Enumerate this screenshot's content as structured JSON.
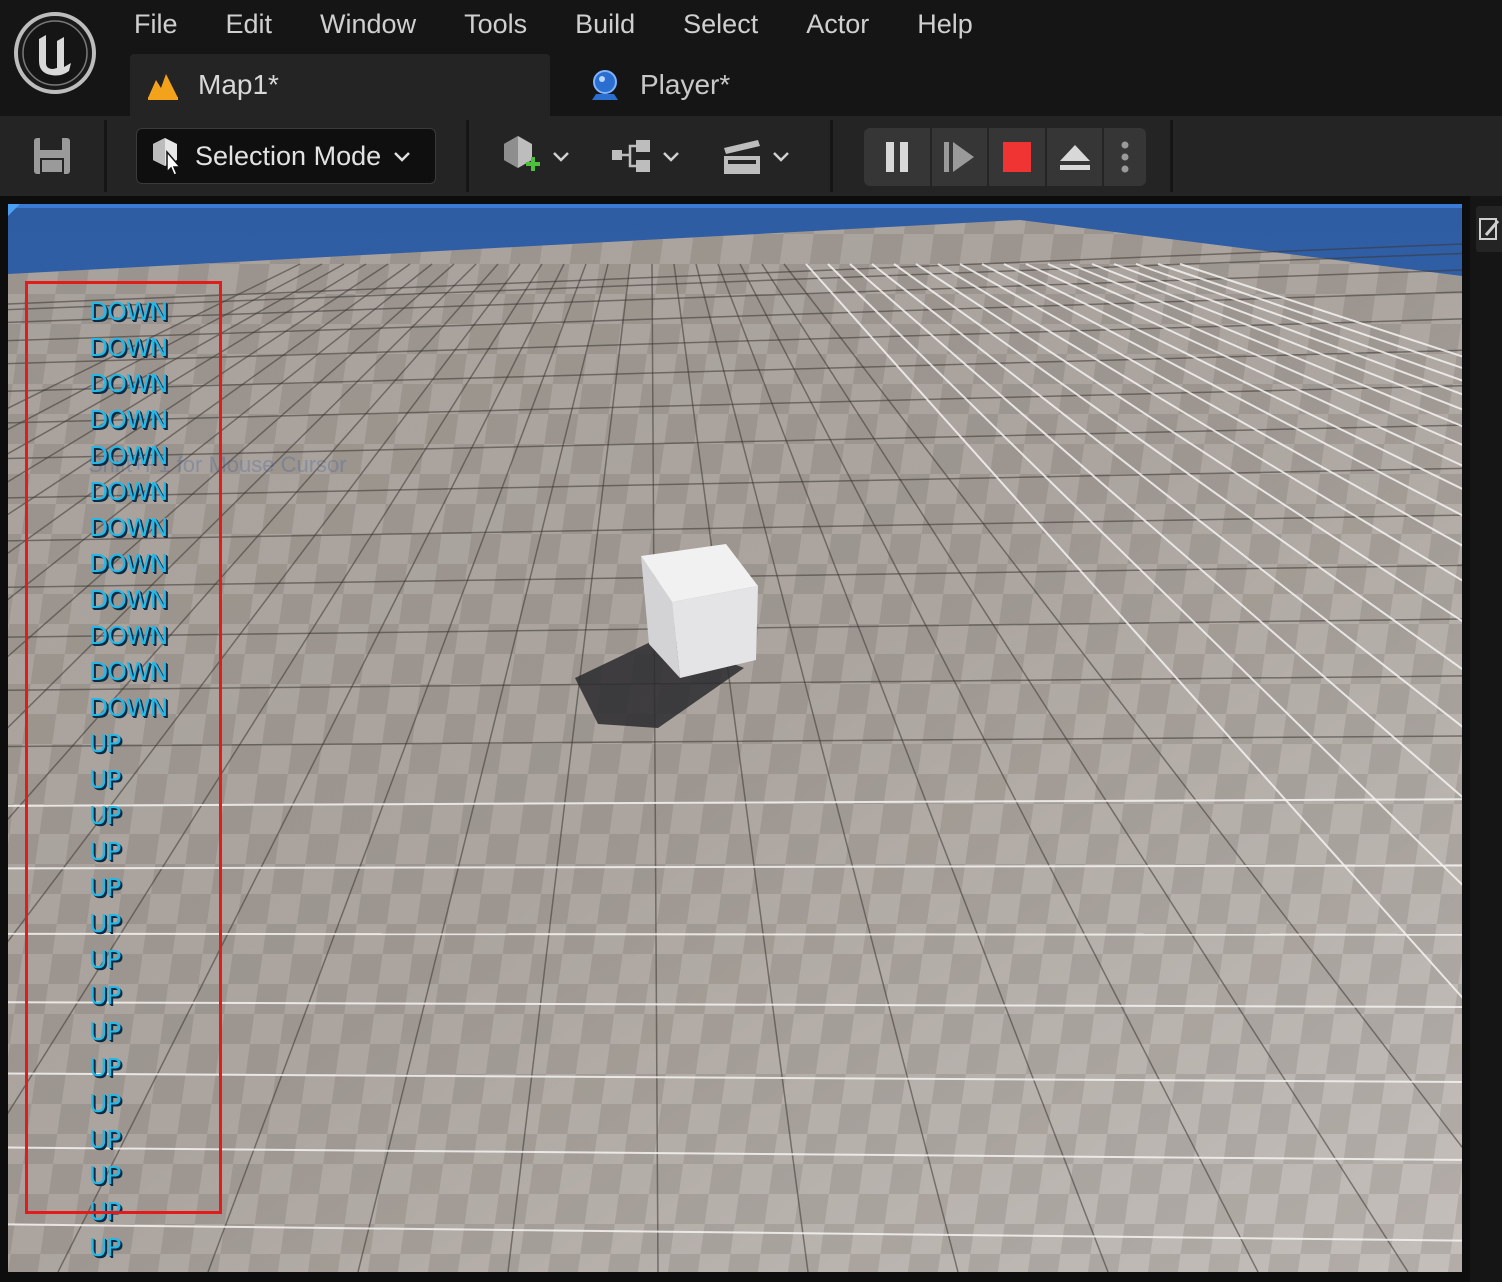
{
  "menu": [
    "File",
    "Edit",
    "Window",
    "Tools",
    "Build",
    "Select",
    "Actor",
    "Help"
  ],
  "tabs": [
    {
      "label": "Map1*",
      "icon": "level-map-icon",
      "active": true
    },
    {
      "label": "Player*",
      "icon": "blueprint-pawn-icon",
      "active": false
    }
  ],
  "toolbar": {
    "save": "save-icon",
    "mode_label": "Selection Mode",
    "buttons": [
      "add-actor-icon",
      "blueprint-icon",
      "cinematics-icon"
    ],
    "play_controls": [
      "pause-icon",
      "skip-frame-icon",
      "stop-icon",
      "eject-icon",
      "more-options-icon"
    ],
    "stop_color": "#f03434"
  },
  "viewport": {
    "hint_text": "Shift+F1 for Mouse Cursor",
    "log_color": "#25b8e6",
    "highlight_color": "#e21b1b",
    "log_lines": [
      "DOWN",
      "DOWN",
      "DOWN",
      "DOWN",
      "DOWN",
      "DOWN",
      "DOWN",
      "DOWN",
      "DOWN",
      "DOWN",
      "DOWN",
      "DOWN",
      "UP",
      "UP",
      "UP",
      "UP",
      "UP",
      "UP",
      "UP",
      "UP",
      "UP",
      "UP",
      "UP",
      "UP",
      "UP",
      "UP",
      "UP"
    ]
  }
}
